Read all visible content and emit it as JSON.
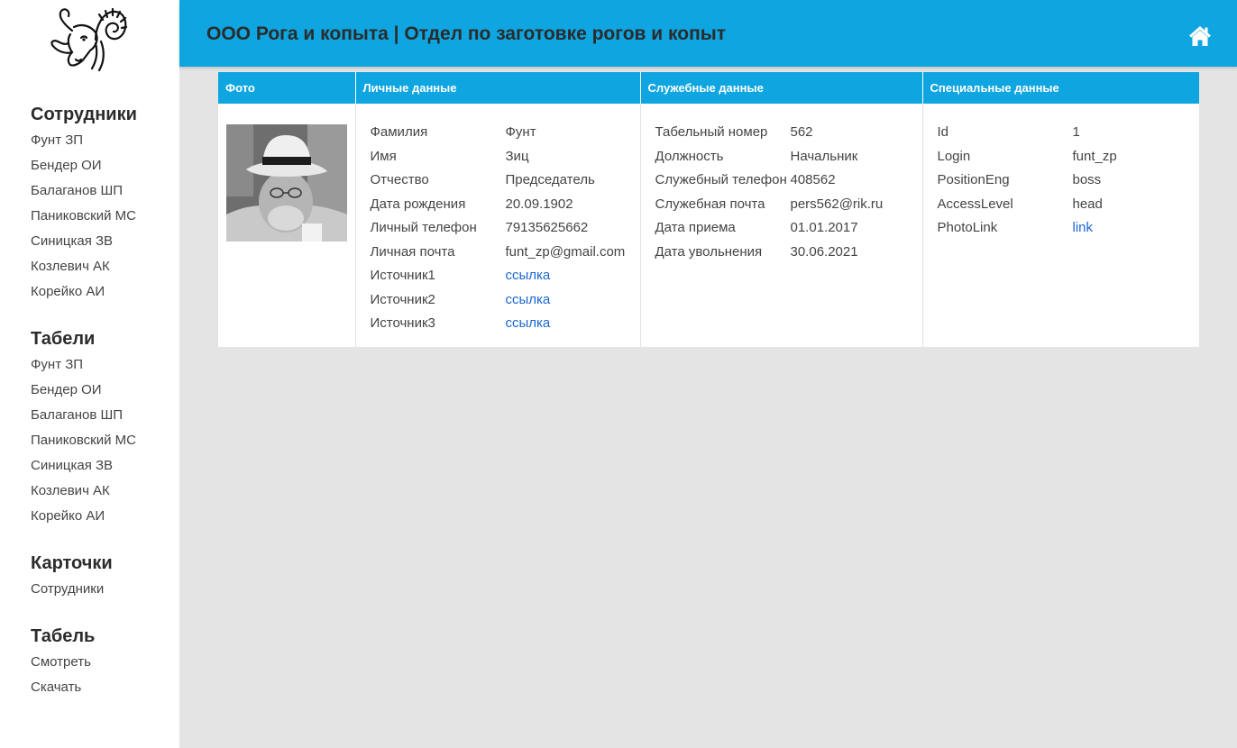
{
  "app": {
    "title": "ООО Рога и копыта | Отдел по заготовке рогов и копыт"
  },
  "icons": {
    "logo": "ram-head-logo",
    "home": "home-icon"
  },
  "colors": {
    "accent": "#0ea5e0",
    "link": "#1a66d2"
  },
  "sidebar": {
    "sections": [
      {
        "heading": "Сотрудники",
        "items": [
          "Фунт ЗП",
          "Бендер ОИ",
          "Балаганов ШП",
          "Паниковский МС",
          "Синицкая ЗВ",
          "Козлевич АК",
          "Корейко АИ"
        ]
      },
      {
        "heading": "Табели",
        "items": [
          "Фунт ЗП",
          "Бендер ОИ",
          "Балаганов ШП",
          "Паниковский МС",
          "Синицкая ЗВ",
          "Козлевич АК",
          "Корейко АИ"
        ]
      },
      {
        "heading": "Карточки",
        "items": [
          "Сотрудники"
        ]
      },
      {
        "heading": "Табель",
        "items": [
          "Смотреть",
          "Скачать"
        ]
      }
    ]
  },
  "card": {
    "headers": [
      "Фото",
      "Личные данные",
      "Служебные данные",
      "Специальные данные"
    ],
    "personal": [
      {
        "key": "Фамилия",
        "value": "Фунт"
      },
      {
        "key": "Имя",
        "value": "Зиц"
      },
      {
        "key": "Отчество",
        "value": "Председатель"
      },
      {
        "key": "Дата рождения",
        "value": "20.09.1902"
      },
      {
        "key": "Личный телефон",
        "value": "79135625662"
      },
      {
        "key": "Личная почта",
        "value": "funt_zp@gmail.com"
      },
      {
        "key": "Источник1",
        "value": "ссылка",
        "link": true
      },
      {
        "key": "Источник2",
        "value": "ссылка",
        "link": true
      },
      {
        "key": "Источник3",
        "value": "ссылка",
        "link": true
      }
    ],
    "service": [
      {
        "key": "Табельный номер",
        "value": "562"
      },
      {
        "key": "Должность",
        "value": "Начальник"
      },
      {
        "key": "Служебный телефон",
        "value": "408562"
      },
      {
        "key": "Служебная почта",
        "value": "pers562@rik.ru"
      },
      {
        "key": "Дата приема",
        "value": "01.01.2017"
      },
      {
        "key": "Дата увольнения",
        "value": "30.06.2021"
      }
    ],
    "special": [
      {
        "key": "Id",
        "value": "1"
      },
      {
        "key": "Login",
        "value": "funt_zp"
      },
      {
        "key": "PositionEng",
        "value": "boss"
      },
      {
        "key": "AccessLevel",
        "value": "head"
      },
      {
        "key": "PhotoLink",
        "value": "link",
        "link": true
      }
    ]
  }
}
